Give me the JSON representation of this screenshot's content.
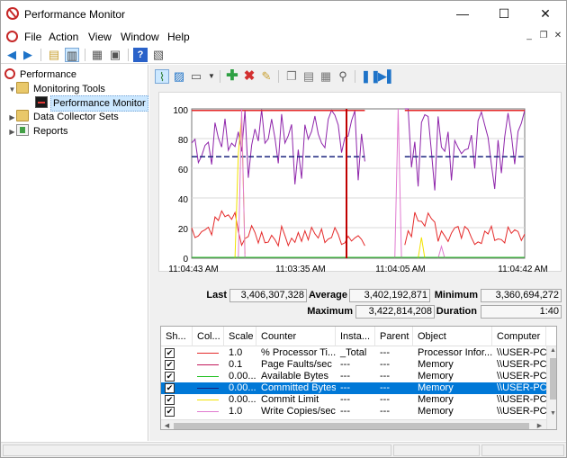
{
  "window": {
    "title": "Performance Monitor",
    "minimize": "—",
    "maximize": "☐",
    "close": "✕"
  },
  "menu": {
    "file": "File",
    "action": "Action",
    "view": "View",
    "window": "Window",
    "help": "Help"
  },
  "mdi": {
    "minimize": "_",
    "restore": "❐",
    "close": "✕"
  },
  "tree": {
    "root": "Performance",
    "monitoring_tools": "Monitoring Tools",
    "performance_monitor": "Performance Monitor",
    "data_collector_sets": "Data Collector Sets",
    "reports": "Reports"
  },
  "stats": {
    "last_label": "Last",
    "last": "3,406,307,328",
    "average_label": "Average",
    "average": "3,402,192,871",
    "minimum_label": "Minimum",
    "minimum": "3,360,694,272",
    "maximum_label": "Maximum",
    "maximum": "3,422,814,208",
    "duration_label": "Duration",
    "duration": "1:40"
  },
  "graph": {
    "y_ticks": [
      "100",
      "80",
      "60",
      "40",
      "20",
      "0"
    ],
    "x_ticks": [
      "11:04:43 AM",
      "11:03:35 AM",
      "11:04:05 AM",
      "11:04:42 AM"
    ]
  },
  "columns": [
    "Sh...",
    "Col...",
    "Scale",
    "Counter",
    "Insta...",
    "Parent",
    "Object",
    "Computer"
  ],
  "counters": [
    {
      "show": true,
      "color": "#e52b2b",
      "scale": "1.0",
      "counter": "% Processor Ti...",
      "instance": "_Total",
      "parent": "---",
      "object": "Processor Infor...",
      "computer": "\\\\USER-PC",
      "selected": false
    },
    {
      "show": true,
      "color": "#c2185b",
      "scale": "0.1",
      "counter": "Page Faults/sec",
      "instance": "---",
      "parent": "---",
      "object": "Memory",
      "computer": "\\\\USER-PC",
      "selected": false
    },
    {
      "show": true,
      "color": "#22c022",
      "scale": "0.00...",
      "counter": "Available Bytes",
      "instance": "---",
      "parent": "---",
      "object": "Memory",
      "computer": "\\\\USER-PC",
      "selected": false
    },
    {
      "show": true,
      "color": "#1a237e",
      "scale": "0.00...",
      "counter": "Committed Bytes",
      "instance": "---",
      "parent": "---",
      "object": "Memory",
      "computer": "\\\\USER-PC",
      "selected": true
    },
    {
      "show": true,
      "color": "#f2e200",
      "scale": "0.00...",
      "counter": "Commit Limit",
      "instance": "---",
      "parent": "---",
      "object": "Memory",
      "computer": "\\\\USER-PC",
      "selected": false
    },
    {
      "show": true,
      "color": "#e07ad0",
      "scale": "1.0",
      "counter": "Write Copies/sec",
      "instance": "---",
      "parent": "---",
      "object": "Memory",
      "computer": "\\\\USER-PC",
      "selected": false
    }
  ],
  "colors": {
    "processor": "#e52b2b",
    "committed": "#1a237e",
    "purple_series": "#8e24aa",
    "commit_limit": "#f2e200",
    "write_copies": "#e07ad0",
    "available": "#22c022",
    "selection": "#0078d7"
  }
}
